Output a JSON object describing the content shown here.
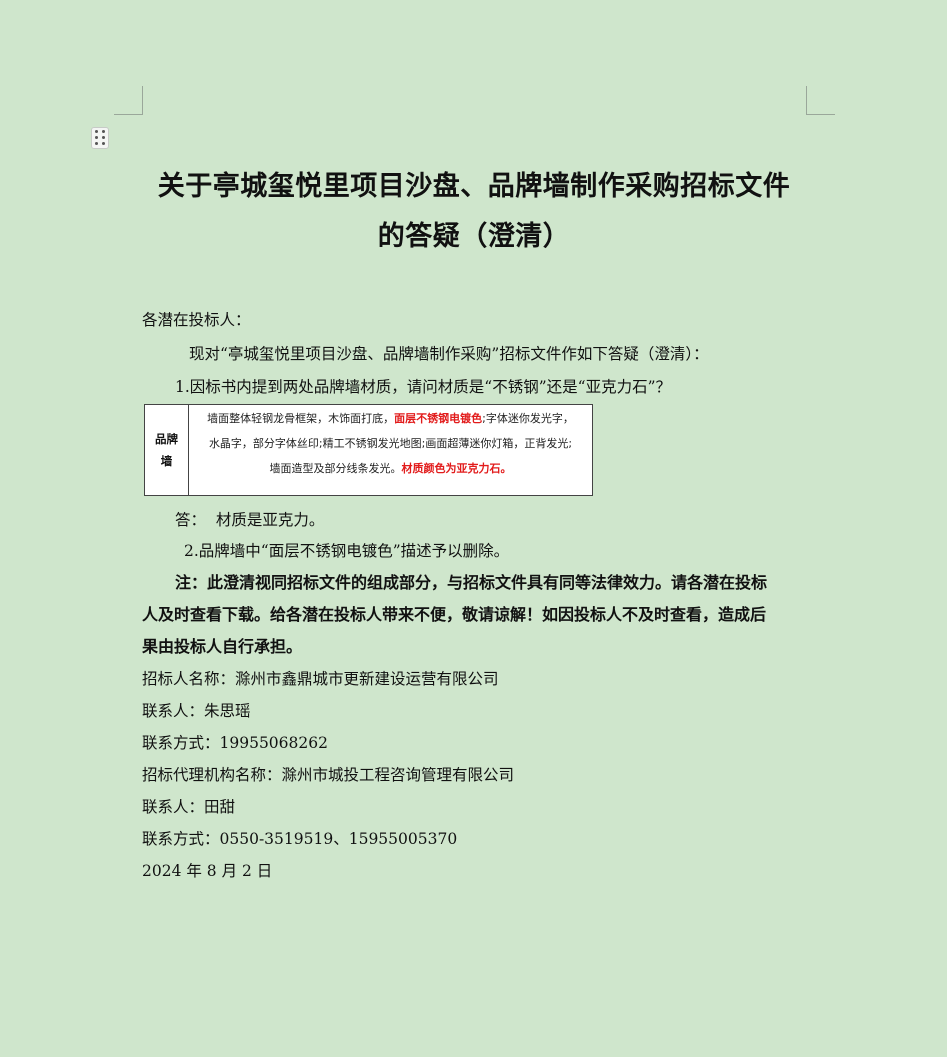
{
  "title": {
    "line1": "关于亭城玺悦里项目沙盘、品牌墙制作采购招标文件",
    "line2": "的答疑（澄清）"
  },
  "salutation": "各潜在投标人：",
  "intro": "现对“亭城玺悦里项目沙盘、品牌墙制作采购”招标文件作如下答疑（澄清）：",
  "question1": "1.因标书内提到两处品牌墙材质，请问材质是“不锈钢”还是“亚克力石”？",
  "excerpt": {
    "head1": "品牌",
    "head2": "墙",
    "l1a": "墙面整体轻钢龙骨框架，木饰面打底，",
    "l1red": "面层不锈钢电镀色",
    "l1b": ";字体迷你发光字，",
    "l2": "水晶字，部分字体丝印;精工不锈钢发光地图;画面超薄迷你灯箱，正背发光;",
    "l3a": "墙面造型及部分线条发光。",
    "l3red": "材质颜色为亚克力石。"
  },
  "answer1": "答：  材质是亚克力。",
  "item2": "2.品牌墙中“面层不锈钢电镀色”描述予以删除。",
  "note": {
    "line1": "注：此澄清视同招标文件的组成部分，与招标文件具有同等法律效力。请各潜在投标",
    "line2": "人及时查看下载。给各潜在投标人带来不便，敬请谅解！如因投标人不及时查看，造成后",
    "line3": "果由投标人自行承担。"
  },
  "tenderer_name": "招标人名称：滁州市鑫鼎城市更新建设运营有限公司",
  "contact1": "联系人：朱思瑶",
  "phone1": "联系方式：19955068262",
  "agency_name": "招标代理机构名称：滁州市城投工程咨询管理有限公司",
  "contact2": "联系人：田甜",
  "phone2": "联系方式：0550-3519519、15955005370",
  "date": "2024 年 8 月 2 日"
}
